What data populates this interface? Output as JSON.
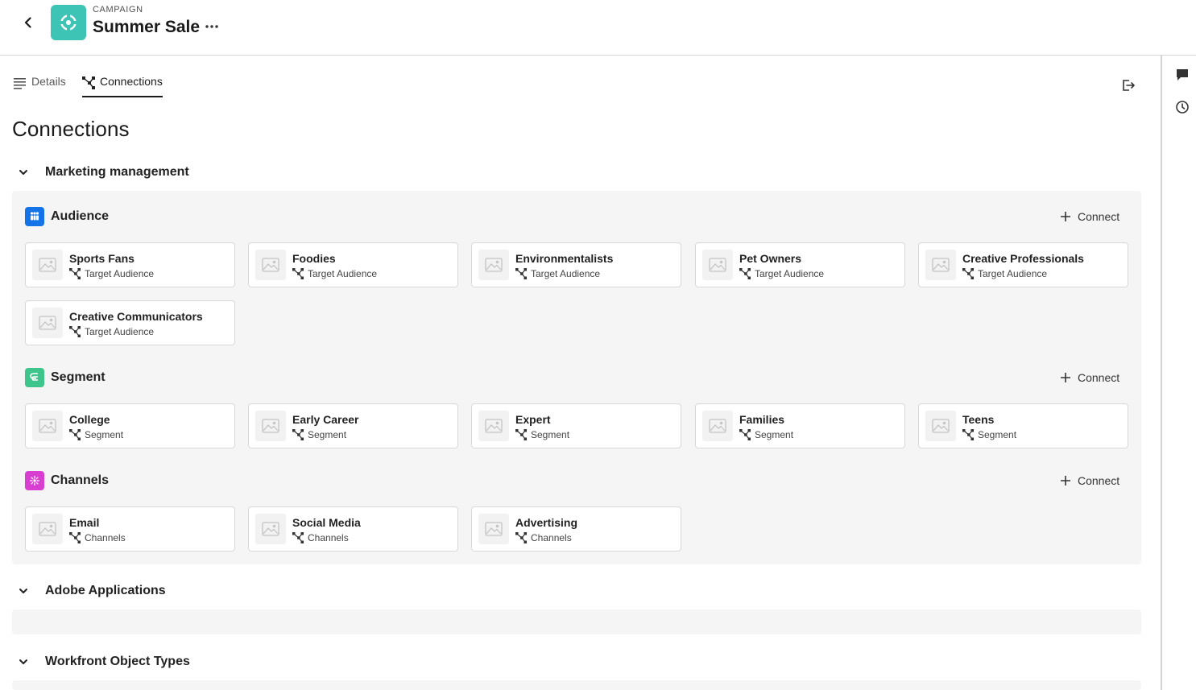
{
  "header": {
    "crumb": "CAMPAIGN",
    "title": "Summer Sale"
  },
  "tabs": [
    {
      "label": "Details",
      "active": false
    },
    {
      "label": "Connections",
      "active": true
    }
  ],
  "page_title": "Connections",
  "sections": {
    "marketing": {
      "label": "Marketing management",
      "groups": {
        "audience": {
          "label": "Audience",
          "color": "#1473e6",
          "connect": "Connect",
          "items": [
            {
              "name": "Sports Fans",
              "type": "Target Audience"
            },
            {
              "name": "Foodies",
              "type": "Target Audience"
            },
            {
              "name": "Environmentalists",
              "type": "Target Audience"
            },
            {
              "name": "Pet Owners",
              "type": "Target Audience"
            },
            {
              "name": "Creative Professionals",
              "type": "Target Audience"
            },
            {
              "name": "Creative Communicators",
              "type": "Target Audience"
            }
          ]
        },
        "segment": {
          "label": "Segment",
          "color": "#3dc58c",
          "connect": "Connect",
          "items": [
            {
              "name": "College",
              "type": "Segment"
            },
            {
              "name": "Early Career",
              "type": "Segment"
            },
            {
              "name": "Expert",
              "type": "Segment"
            },
            {
              "name": "Families",
              "type": "Segment"
            },
            {
              "name": "Teens",
              "type": "Segment"
            }
          ]
        },
        "channels": {
          "label": "Channels",
          "color": "#d83fd0",
          "connect": "Connect",
          "items": [
            {
              "name": "Email",
              "type": "Channels"
            },
            {
              "name": "Social Media",
              "type": "Channels"
            },
            {
              "name": "Advertising",
              "type": "Channels"
            }
          ]
        }
      }
    },
    "adobe": {
      "label": "Adobe Applications"
    },
    "workfront": {
      "label": "Workfront Object Types"
    }
  },
  "icons": {
    "back": "chevron-left-icon",
    "app": "campaign-target-icon",
    "more": "more-icon",
    "comment": "comment-icon",
    "history": "history-icon",
    "export": "export-icon",
    "connection": "connection-icon",
    "image_placeholder": "image-icon"
  },
  "colors": {
    "app_tile": "#3ec4b5",
    "panel_bg": "#f5f5f5"
  }
}
